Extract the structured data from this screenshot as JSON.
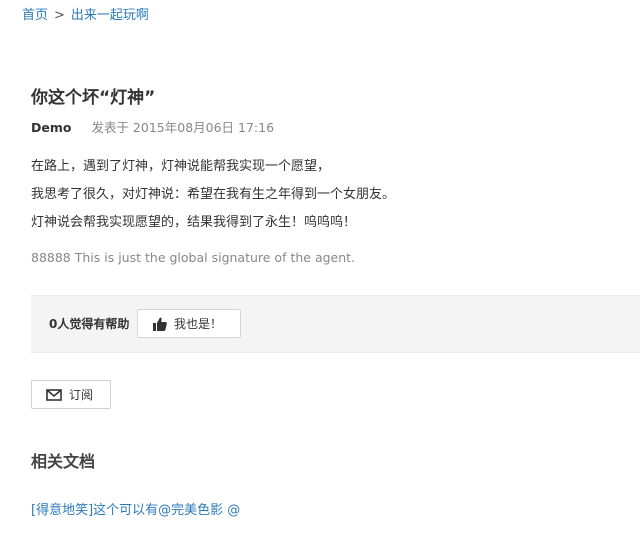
{
  "breadcrumb": {
    "home": "首页",
    "separator": ">",
    "current": "出来一起玩啊"
  },
  "post": {
    "title": "你这个坏“灯神”",
    "author": "Demo",
    "posted": "发表于 2015年08月06日 17:16",
    "lines": [
      "在路上，遇到了灯神，灯神说能帮我实现一个愿望，",
      "我思考了很久，对灯神说：希望在我有生之年得到一个女朋友。",
      "灯神说会帮我实现愿望的，结果我得到了永生！呜呜呜！"
    ],
    "signature": "88888 This is just the global signature of the agent."
  },
  "helpful": {
    "count_text": "0人觉得有帮助",
    "button_label": "我也是！",
    "icon": "thumbs-up-icon"
  },
  "subscribe": {
    "label": "订阅",
    "icon": "envelope-icon"
  },
  "related": {
    "heading": "相关文档",
    "items": [
      {
        "label": "[得意地笑]这个可以有@完美色影 @"
      }
    ]
  },
  "colors": {
    "link": "#2b7bb9",
    "muted": "#888888",
    "panel": "#f4f4f4"
  }
}
